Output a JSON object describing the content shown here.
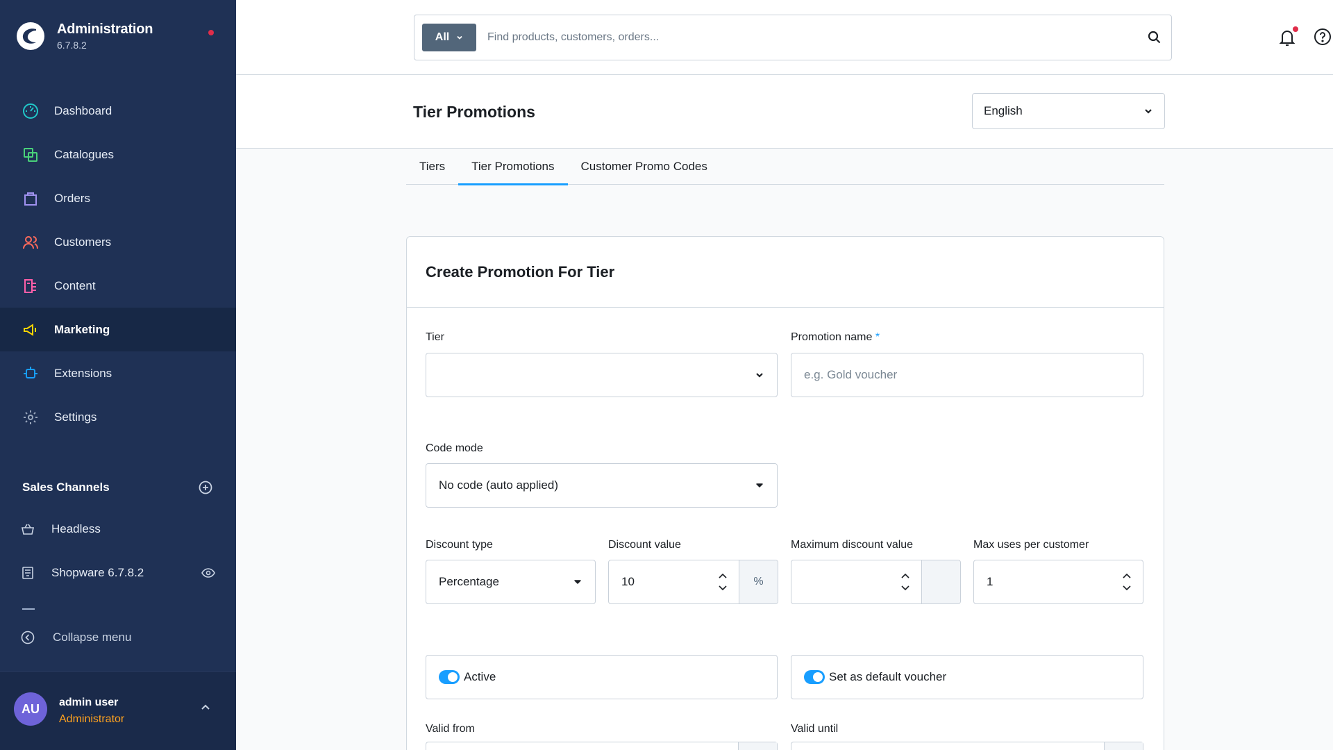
{
  "brand": {
    "title": "Administration",
    "version": "6.7.8.2"
  },
  "nav": {
    "items": [
      {
        "label": "Dashboard",
        "icon": "dashboard-icon",
        "color": "#21c7c9"
      },
      {
        "label": "Catalogues",
        "icon": "catalogues-icon",
        "color": "#49d27a"
      },
      {
        "label": "Orders",
        "icon": "orders-icon",
        "color": "#a092f0"
      },
      {
        "label": "Customers",
        "icon": "customers-icon",
        "color": "#ff6b5b"
      },
      {
        "label": "Content",
        "icon": "content-icon",
        "color": "#ff5ea8"
      },
      {
        "label": "Marketing",
        "icon": "marketing-icon",
        "color": "#ffd600"
      },
      {
        "label": "Extensions",
        "icon": "extensions-icon",
        "color": "#189eff"
      },
      {
        "label": "Settings",
        "icon": "settings-icon",
        "color": "#9aa8bd"
      }
    ],
    "active_index": 5
  },
  "sales_channels": {
    "title": "Sales Channels",
    "items": [
      {
        "label": "Headless",
        "icon": "basket-icon"
      },
      {
        "label": "Shopware 6.7.8.2",
        "icon": "storefront-icon"
      }
    ]
  },
  "collapse_label": "Collapse menu",
  "user": {
    "initials": "AU",
    "name": "admin user",
    "role": "Administrator"
  },
  "search": {
    "type_label": "All",
    "placeholder": "Find products, customers, orders..."
  },
  "page": {
    "title": "Tier Promotions",
    "language": "English"
  },
  "tabs": [
    {
      "label": "Tiers"
    },
    {
      "label": "Tier Promotions"
    },
    {
      "label": "Customer Promo Codes"
    }
  ],
  "active_tab": 1,
  "form": {
    "title": "Create Promotion For Tier",
    "tier_label": "Tier",
    "tier_value": "",
    "promotion_name_label": "Promotion name",
    "promotion_name_required": "*",
    "promotion_name_placeholder": "e.g. Gold voucher",
    "code_mode_label": "Code mode",
    "code_mode_value": "No code (auto applied)",
    "discount_type_label": "Discount type",
    "discount_type_value": "Percentage",
    "discount_value_label": "Discount value",
    "discount_value": "10",
    "discount_suffix": "%",
    "max_discount_label": "Maximum discount value",
    "max_discount_value": "",
    "max_uses_label": "Max uses per customer",
    "max_uses_value": "1",
    "active_label": "Active",
    "active_on": true,
    "default_voucher_label": "Set as default voucher",
    "default_voucher_on": true,
    "valid_from_label": "Valid from",
    "valid_until_label": "Valid until"
  },
  "colors": {
    "sidebar": "#1f3155",
    "accent": "#189eff",
    "role": "#ffa21f",
    "notification": "#e02d4a"
  }
}
